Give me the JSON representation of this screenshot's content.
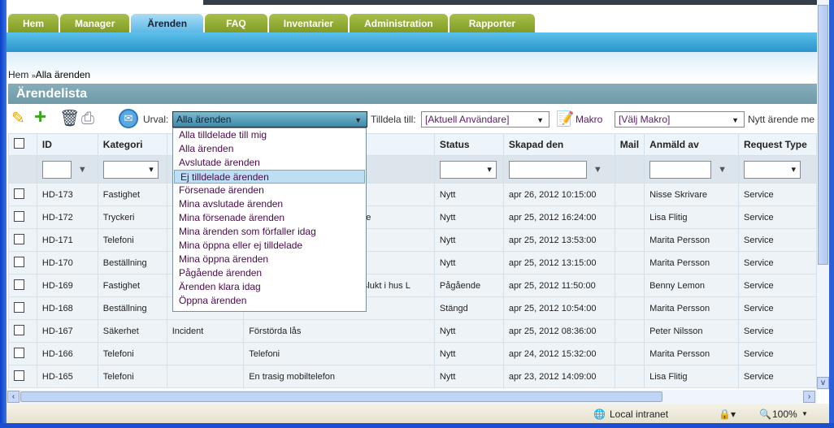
{
  "tabs": [
    "Hem",
    "Manager",
    "Ärenden",
    "FAQ",
    "Inventarier",
    "Administration",
    "Rapporter"
  ],
  "active_tab": "Ärenden",
  "breadcrumb": {
    "home": "Hem",
    "sep": "»",
    "current": "Alla ärenden"
  },
  "title": "Ärendelista",
  "toolbar": {
    "urval_label": "Urval:",
    "urval_value": "Alla ärenden",
    "assign_label": "Tilldela till:",
    "assign_value": "[Aktuell Användare]",
    "macro_label": "Makro",
    "macro_value": "[Välj Makro]",
    "new_case": "Nytt ärende me"
  },
  "dropdown": {
    "options": [
      "Alla tilldelade till mig",
      "Alla ärenden",
      "Avslutade ärenden",
      "Ej tilldelade ärenden",
      "Försenade ärenden",
      "Mina avslutade ärenden",
      "Mina försenade ärenden",
      "Mina ärenden som förfaller idag",
      "Mina öppna eller ej tilldelade",
      "Mina öppna ärenden",
      "Pågående ärenden",
      "Ärenden klara idag",
      "Öppna ärenden"
    ],
    "highlighted": "Ej tilldelade ärenden"
  },
  "columns": [
    "ID",
    "Kategori",
    "",
    "",
    "Status",
    "Skapad den",
    "Mail",
    "Anmäld av",
    "Request Type"
  ],
  "rows": [
    [
      "HD-173",
      "Fastighet",
      "",
      "",
      "Nytt",
      "apr 26, 2012 10:15:00",
      "",
      "Nisse Skrivare",
      "Service"
    ],
    [
      "HD-172",
      "Tryckeri",
      "",
      "e",
      "Nytt",
      "apr 25, 2012 16:24:00",
      "",
      "Lisa Flitig",
      "Service"
    ],
    [
      "HD-171",
      "Telefoni",
      "",
      "",
      "Nytt",
      "apr 25, 2012 13:53:00",
      "",
      "Marita Persson",
      "Service"
    ],
    [
      "HD-170",
      "Beställning",
      "",
      "",
      "Nytt",
      "apr 25, 2012 13:15:00",
      "",
      "Marita Persson",
      "Service"
    ],
    [
      "HD-169",
      "Fastighet",
      "",
      "ajslukt i hus L",
      "Pågående",
      "apr 25, 2012 11:50:00",
      "",
      "Benny Lemon",
      "Service"
    ],
    [
      "HD-168",
      "Beställning",
      "",
      "",
      "Stängd",
      "apr 25, 2012 10:54:00",
      "",
      "Marita Persson",
      "Service"
    ],
    [
      "HD-167",
      "Säkerhet",
      "Incident",
      "Förstörda lås",
      "Nytt",
      "apr 25, 2012 08:36:00",
      "",
      "Peter Nilsson",
      "Service"
    ],
    [
      "HD-166",
      "Telefoni",
      "",
      "Telefoni",
      "Nytt",
      "apr 24, 2012 15:32:00",
      "",
      "Marita Persson",
      "Service"
    ],
    [
      "HD-165",
      "Telefoni",
      "",
      "En trasig mobiltelefon",
      "Nytt",
      "apr 23, 2012 14:09:00",
      "",
      "Lisa Flitig",
      "Service"
    ]
  ],
  "statusbar": {
    "zone": "Local intranet",
    "zoom": "100%"
  },
  "colors": {
    "tab_green": "#8fab30",
    "tab_active": "#7cc8ee",
    "blue_bar": "#3aa4d8",
    "title_bar": "#7aa3b0"
  }
}
